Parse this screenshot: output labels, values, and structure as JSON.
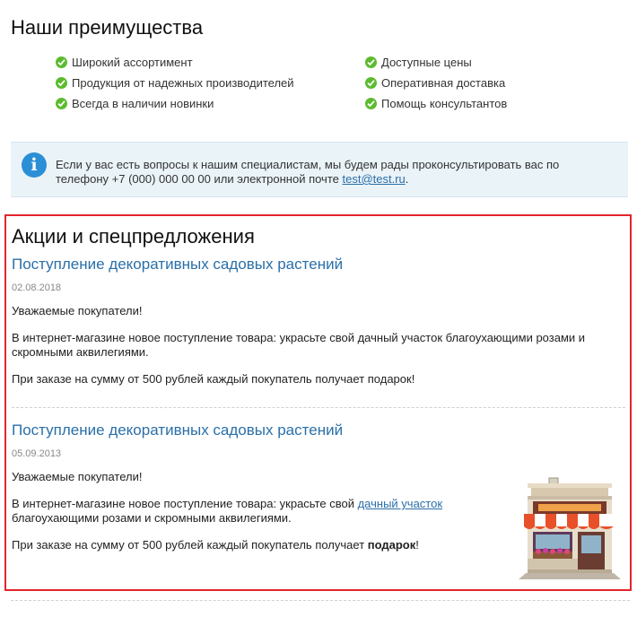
{
  "advantages": {
    "title": "Наши преимущества",
    "left_items": [
      "Широкий ассортимент",
      "Продукция от надежных производителей",
      "Всегда в наличии новинки"
    ],
    "right_items": [
      "Доступные цены",
      "Оперативная доставка",
      "Помощь консультантов"
    ]
  },
  "info": {
    "text_before": "Если у вас есть вопросы к нашим специалистам, мы будем рады проконсультировать вас по телефону +7 (000) 000 00 00 или электронной почте ",
    "email": "test@test.ru",
    "text_after": "."
  },
  "promo": {
    "title": "Акции и спецпредложения",
    "articles": [
      {
        "title": "Поступление декоративных садовых растений",
        "date": "02.08.2018",
        "greeting": "Уважаемые покупатели!",
        "para1": "В интернет-магазине новое поступление товара: украсьте свой дачный участок благоухающими розами и скромными аквилегиями.",
        "para2": "При заказе на сумму от 500 рублей каждый покупатель получает подарок!"
      },
      {
        "title": "Поступление декоративных садовых растений",
        "date": "05.09.2013",
        "greeting": "Уважаемые покупатели!",
        "para1_before": "В интернет-магазине новое поступление товара: украсьте свой ",
        "para1_link": "дачный участок",
        "para1_after": "благоухающими розами и скромными аквилегиями.",
        "para2_before": "При заказе на сумму от 500 рублей каждый покупатель получает ",
        "para2_bold": "подарок",
        "para2_after": "!"
      }
    ]
  },
  "colors": {
    "check": "#5cbb2f",
    "info_bg": "#eaf3f8",
    "info_icon": "#2b8fd6",
    "link": "#2a6fa8",
    "highlight_border": "#e3242b"
  },
  "icons": {
    "check": "check-icon",
    "info": "info-icon",
    "shop": "shop-icon"
  }
}
